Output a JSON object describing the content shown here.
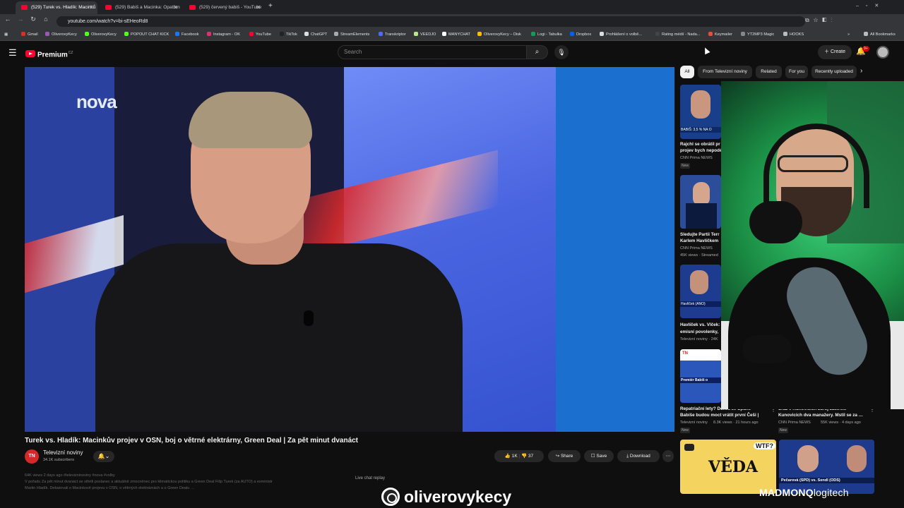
{
  "browser": {
    "tabs": [
      {
        "label": "(529) Turek vs. Hladík: Macinků",
        "active": true
      },
      {
        "label": "(529) Babiš a Macinka: Opatřen",
        "active": false
      },
      {
        "label": "(529) červený babiš - YouTube",
        "active": false
      }
    ],
    "new_tab": "+",
    "url": "youtube.com/watch?v=bi-sEHeoRd8",
    "bookmarks": [
      "Gmail",
      "OliverovyKecy",
      "OliverovyKecy",
      "POPOUT CHAT KICK",
      "Facebook",
      "Instagram - OK",
      "YouTube",
      "TikTok",
      "ChatGPT",
      "StreamElements",
      "Transkriptor",
      "VEEDJO",
      "MANYCHAT",
      "OliverovyKecy – Disk",
      "Logi - Tabulka",
      "Dropbox",
      "Prohlášení o volbě...",
      "Rating médií - Nada...",
      "Keymailer",
      "YT2MP3 Magic",
      "HOOKS"
    ],
    "all_bookmarks": "All Bookmarks"
  },
  "youtube": {
    "logo": "Premium",
    "logo_country": "CZ",
    "search_placeholder": "Search",
    "create_label": "Create",
    "notif_count": "9+"
  },
  "video": {
    "channel_watermark": "nova",
    "title": "Turek vs. Hladík: Macinkův projev v OSN, boj o větrné elektrárny, Green Deal | Za pět minut dvanáct",
    "channel_initials": "TN",
    "channel_name": "Televizní noviny",
    "subscribers": "34.1K subscribers",
    "likes": "1K",
    "dislikes": "37",
    "share_label": "Share",
    "save_label": "Save",
    "download_label": "Download",
    "views_line": "64K views  2 days ago  #televizninoviny #nova #volby",
    "desc_line1": "V pořadu Za pět minut dvanáct se střetli poslanec a aktuálně zmocněnec pro klimatickou politiku a Green Deal Filip Turek (za AUTO) a exministr",
    "desc_line2": "Martin Hladík. Debatovali o Macinkově projevu v OSN, o větrných elektrárnách a o Green Dealu …",
    "live_chat": "Live chat replay"
  },
  "sidebar": {
    "chips": [
      "All",
      "From Televizní noviny",
      "Related",
      "For you",
      "Recently uploaded"
    ],
    "related": [
      {
        "title_1": "Rajchl se obrátil pr",
        "title_2": "projev bych nepodé",
        "channel": "CNN Prima NEWS",
        "badge": "New",
        "thumb_caption": "BABIŠ: 3,5 % NA O"
      },
      {
        "title_1": "Sledujte Partii Terr",
        "title_2": "Karlem Havlíčkem",
        "channel": "CNN Prima NEWS",
        "meta": "45K views · Streamed",
        "thumb_caption": ""
      },
      {
        "title_1": "Havlíček vs. Vlček:",
        "title_2": "emisní povolenky,",
        "channel": "Televizní noviny · 24K",
        "thumb_caption": "Havlíček (ANO)"
      },
      {
        "title_1": "Repatriační lety? Dohra se Spaně",
        "title_2": "Babiše budou moct vrátit první Češi |",
        "channel": "Televizní noviny",
        "meta": "8.3K views · 21 hours ago",
        "badge": "New",
        "thumb_caption": "Premiér Babiš o"
      },
      {
        "title_1": "Sraz v Kunovicích zdroj zastřelil",
        "title_2": "Kunovicích dva manažery. Mstil se za …",
        "channel": "CNN Prima NEWS",
        "meta": "55K views · 4 days ago",
        "badge": "New",
        "thumb_caption": ""
      },
      {
        "title_1": "",
        "title_2": "",
        "channel": "",
        "thumb_caption": "VĚDA",
        "thumb_caption_2": "WTF?"
      },
      {
        "title_1": "",
        "title_2": "",
        "channel": "",
        "thumb_caption": "Pečarová (SPD) vs. Sendl (ODS)"
      }
    ]
  },
  "overlays": {
    "watermark": "oliverovykecy",
    "sponsor_1": "MADMONQ",
    "sponsor_2": "logitech"
  },
  "colors": {
    "yt_red": "#ff0033",
    "bg": "#0f0f0f",
    "chip": "#272727",
    "cam_green": "#3bd17a"
  }
}
